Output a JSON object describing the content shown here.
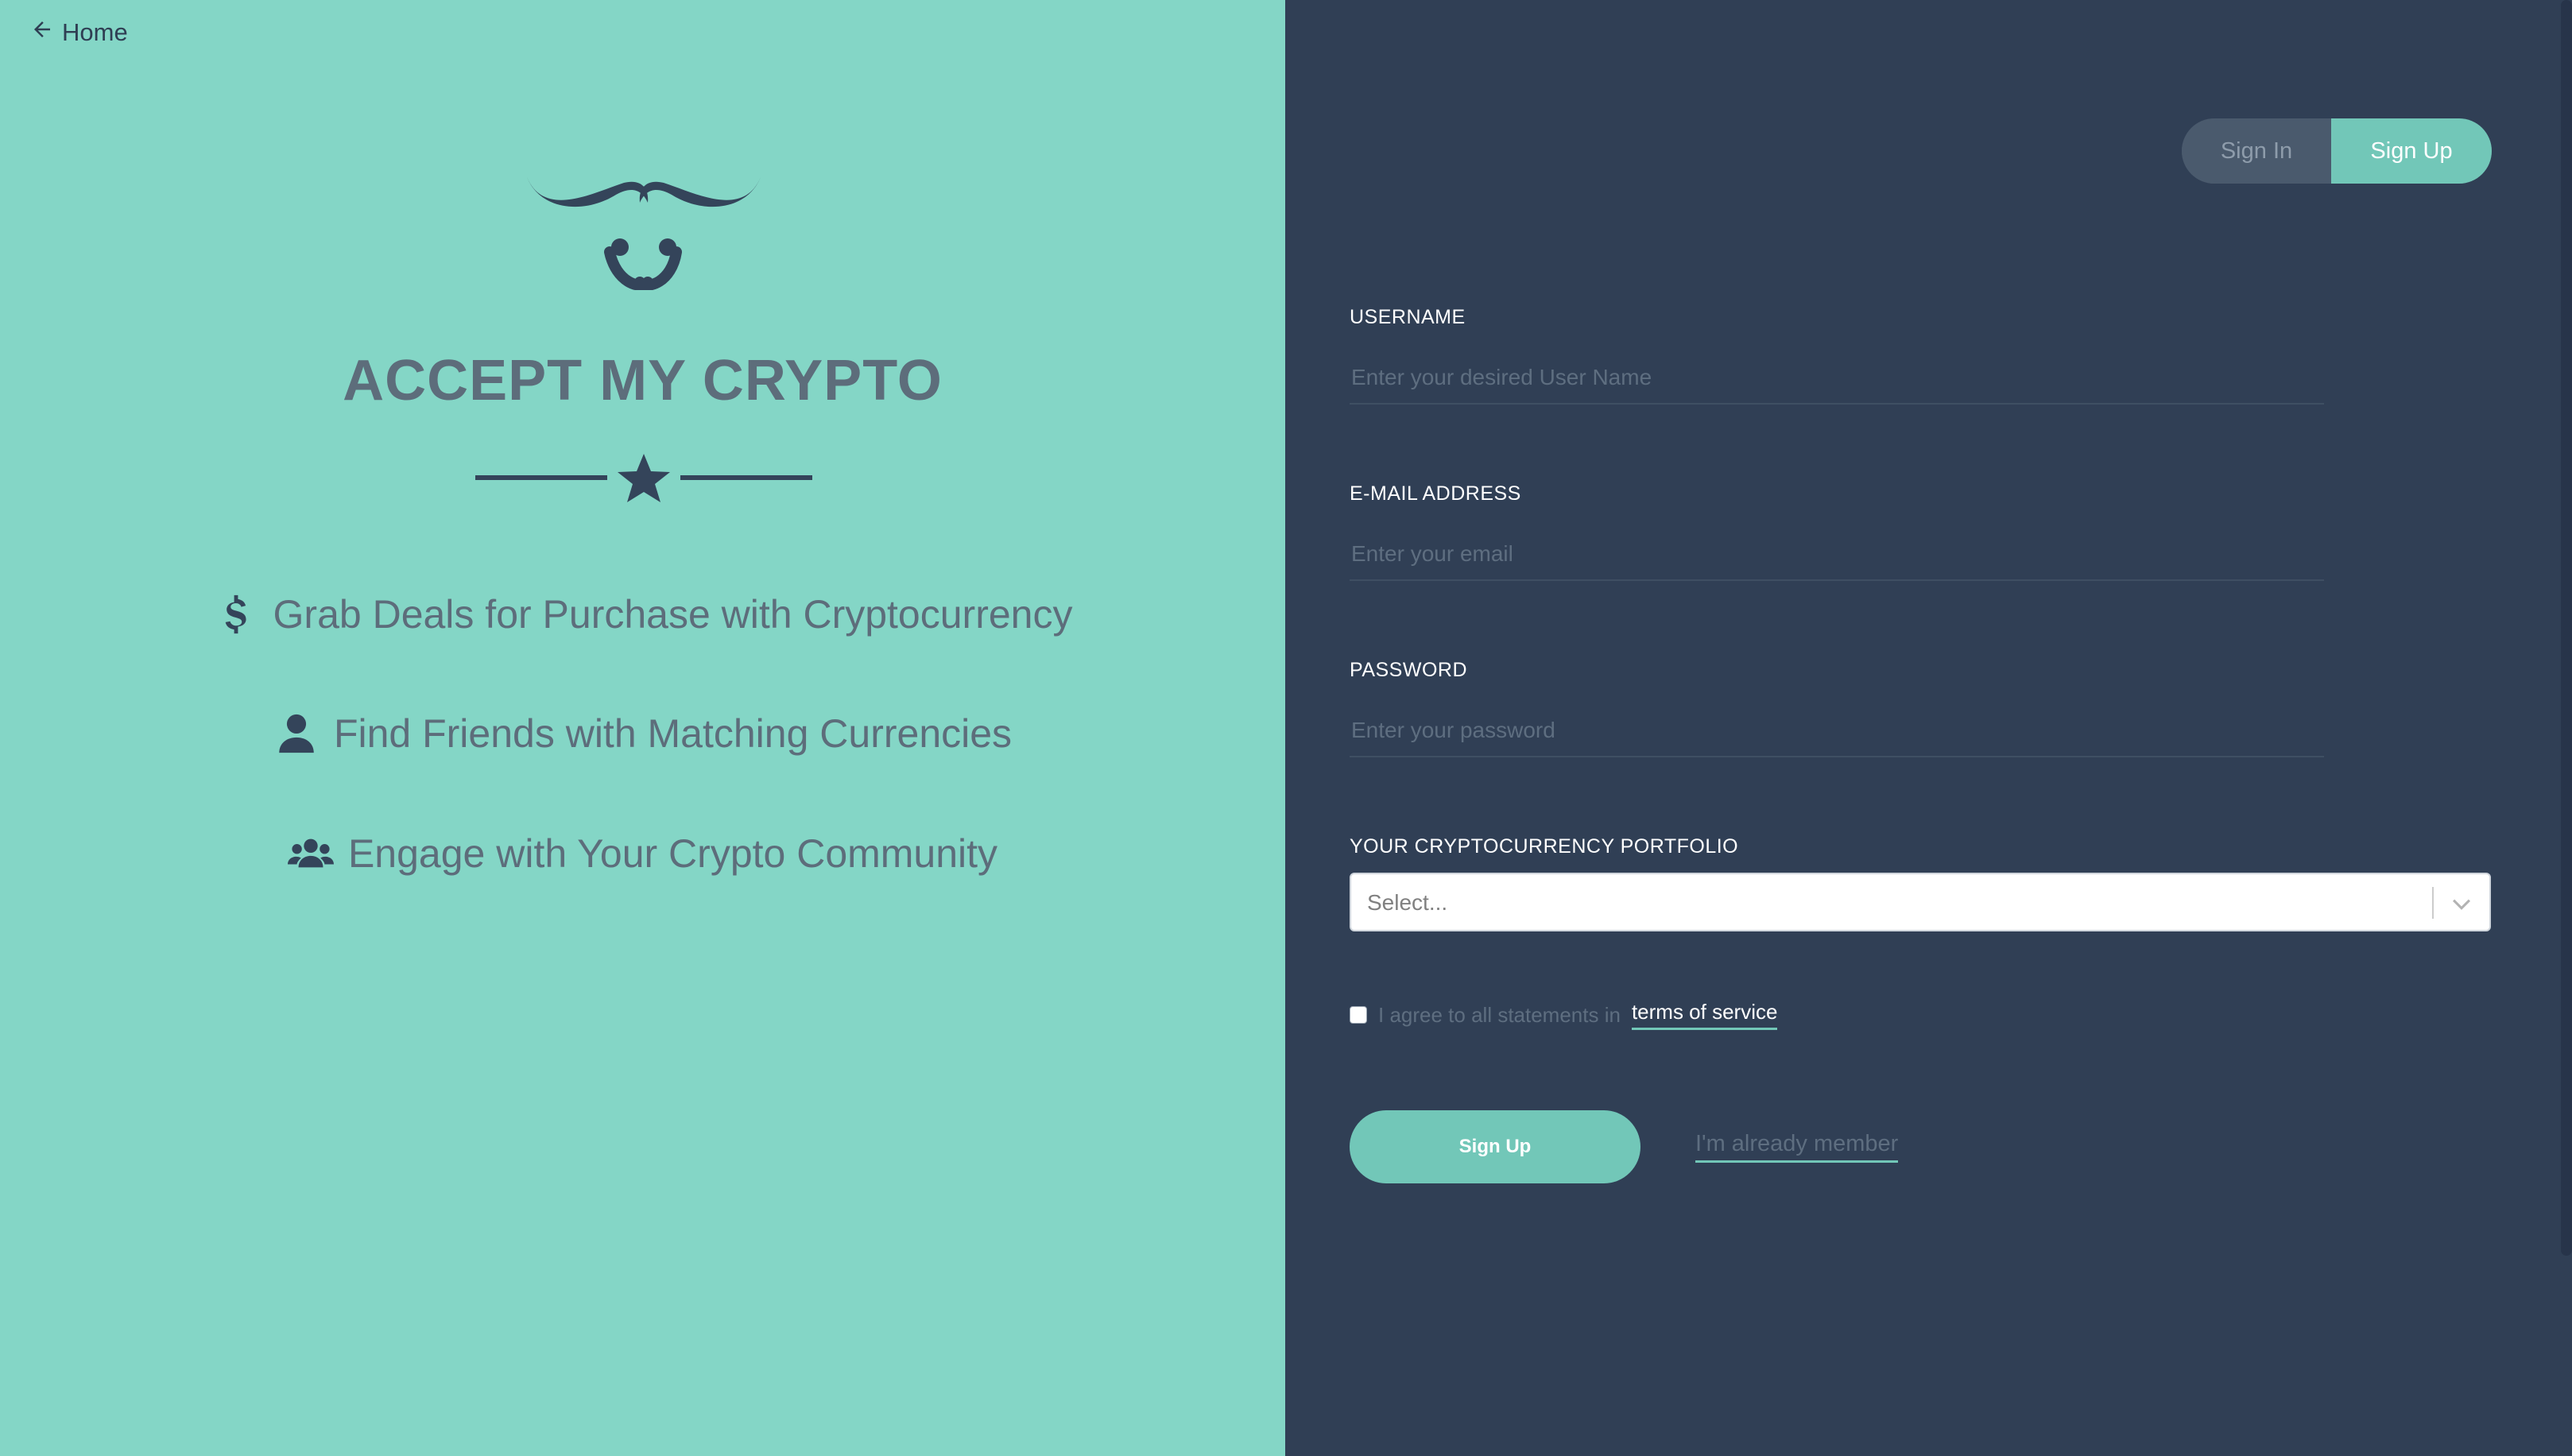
{
  "nav": {
    "home_label": "Home"
  },
  "brand": {
    "title": "ACCEPT MY CRYPTO"
  },
  "features": [
    {
      "icon": "dollar-icon",
      "text": "Grab Deals for Purchase with Cryptocurrency"
    },
    {
      "icon": "user-icon",
      "text": "Find Friends with Matching Currencies"
    },
    {
      "icon": "users-icon",
      "text": "Engage with Your Crypto Community"
    }
  ],
  "tabs": {
    "signin": "Sign In",
    "signup": "Sign Up"
  },
  "form": {
    "username": {
      "label": "USERNAME",
      "placeholder": "Enter your desired User Name",
      "value": ""
    },
    "email": {
      "label": "E-MAIL ADDRESS",
      "placeholder": "Enter your email",
      "value": ""
    },
    "password": {
      "label": "PASSWORD",
      "placeholder": "Enter your password",
      "value": ""
    },
    "portfolio": {
      "label": "YOUR CRYPTOCURRENCY PORTFOLIO",
      "selected": "Select..."
    },
    "agree": {
      "text": "I agree to all statements in",
      "link": "terms of service",
      "checked": false
    },
    "submit_label": "Sign Up",
    "member_link": "I'm already member"
  },
  "colors": {
    "left_bg": "#84d6c6",
    "right_bg": "#303f55",
    "accent": "#72c7b8",
    "muted_text": "#5d6d7b"
  }
}
